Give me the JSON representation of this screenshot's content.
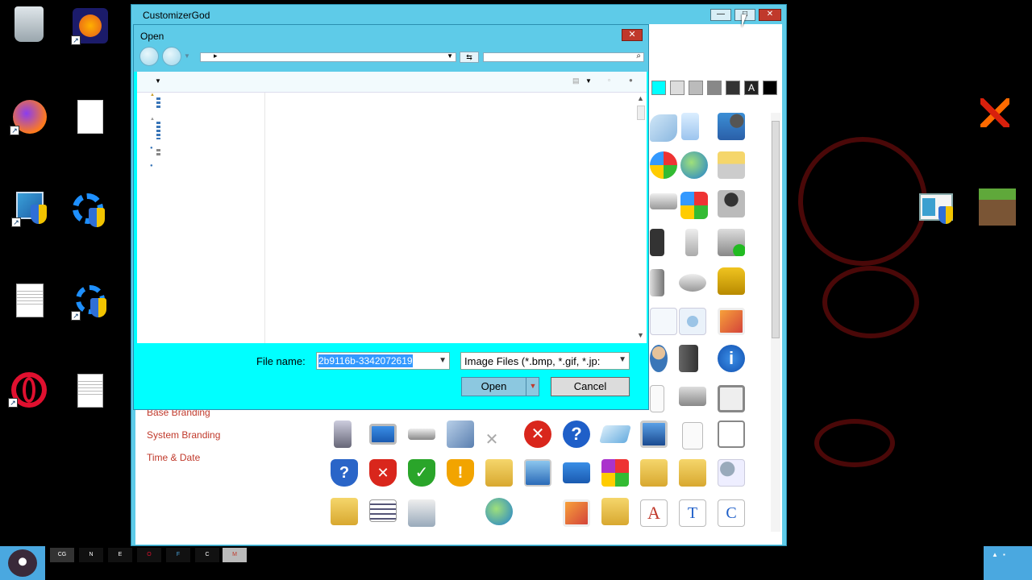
{
  "main_window": {
    "title": "CustomizerGod",
    "minimize": "—",
    "maximize": "□",
    "close": "✕"
  },
  "sidebar_links": [
    "Base Branding",
    "System Branding",
    "Time & Date"
  ],
  "swatches": [
    "#00ffff",
    "#dddddd",
    "#bbbbbb",
    "#888888",
    "#333333",
    "A",
    "#000000"
  ],
  "open_dialog": {
    "title": "Open",
    "close": "✕",
    "file_name_label": "File name:",
    "file_name_value": "2b9116b-3342072619",
    "file_type_value": "Image Files (*.bmp, *.gif, *.jp:",
    "open_button": "Open",
    "cancel_button": "Cancel"
  },
  "taskbar": {
    "items": [
      "CG",
      "N",
      "E",
      "O",
      "F",
      "C",
      "M"
    ]
  }
}
